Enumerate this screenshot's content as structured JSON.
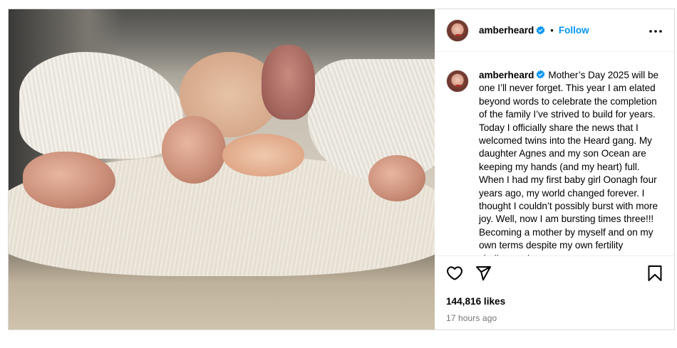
{
  "post": {
    "username": "amberheard",
    "separator": "•",
    "follow_label": "Follow",
    "more_icon": "more-horizontal-icon",
    "verified_color": "#0095f6",
    "caption": "Mother’s Day 2025 will be one I’ll never forget. This year I am elated beyond words to celebrate the completion of the family I’ve strived to build for years. Today I officially share the news that I welcomed twins into the Heard gang. My daughter Agnes and my son Ocean are keeping my hands (and my heart) full. When I had my first baby girl Oonagh four years ago, my world changed forever. I thought I couldn’t possibly burst with more joy. Well, now I am bursting times three!!! Becoming a mother by myself and on my own terms despite my own fertility challenges has",
    "likes": "144,816 likes",
    "timestamp": "17 hours ago",
    "actions": {
      "like_icon": "heart-icon",
      "share_icon": "share-send-icon",
      "save_icon": "bookmark-icon"
    }
  }
}
